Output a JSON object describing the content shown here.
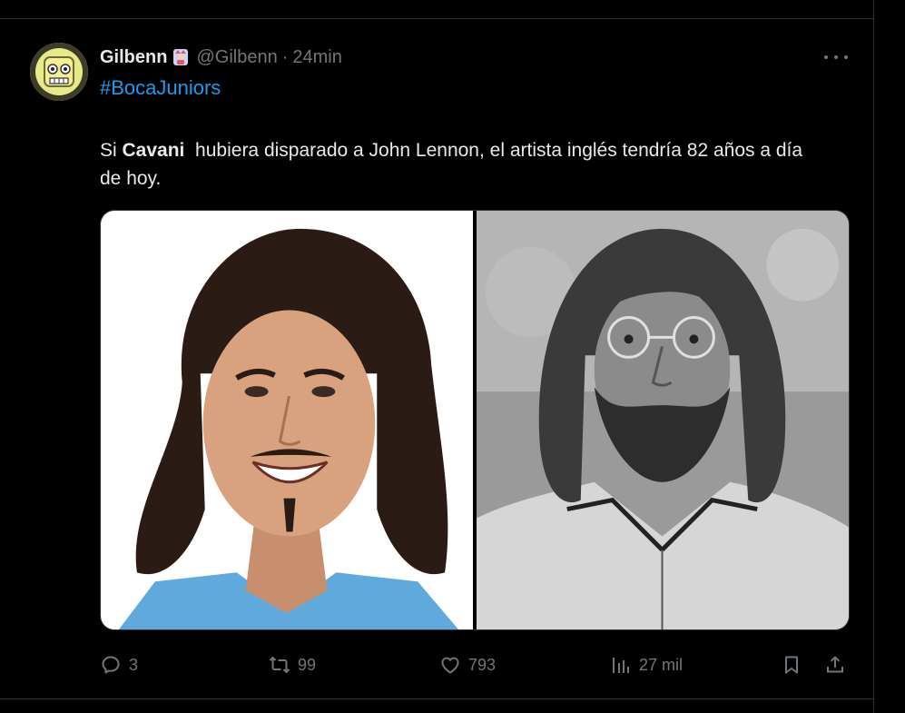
{
  "tweet": {
    "display_name": "Gilbenn",
    "handle": "@Gilbenn",
    "separator": "·",
    "time": "24min",
    "hashtag": "#BocaJuniors",
    "text_part1": "Si ",
    "text_bold": "Cavani",
    "text_part2": "  hubiera disparado a John Lennon, el artista inglés tendría 82 años a día de hoy.",
    "media": [
      {
        "icon": "photo-smiling-long-haired-man-blue-shirt"
      },
      {
        "icon": "photo-bw-man-round-glasses-beard"
      }
    ]
  },
  "actions": {
    "replies": "3",
    "reposts": "99",
    "likes": "793",
    "views": "27 mil"
  },
  "colors": {
    "background": "#000000",
    "text": "#e7e9ea",
    "muted": "#71767b",
    "link": "#1d9bf0",
    "border": "#2f3336"
  }
}
